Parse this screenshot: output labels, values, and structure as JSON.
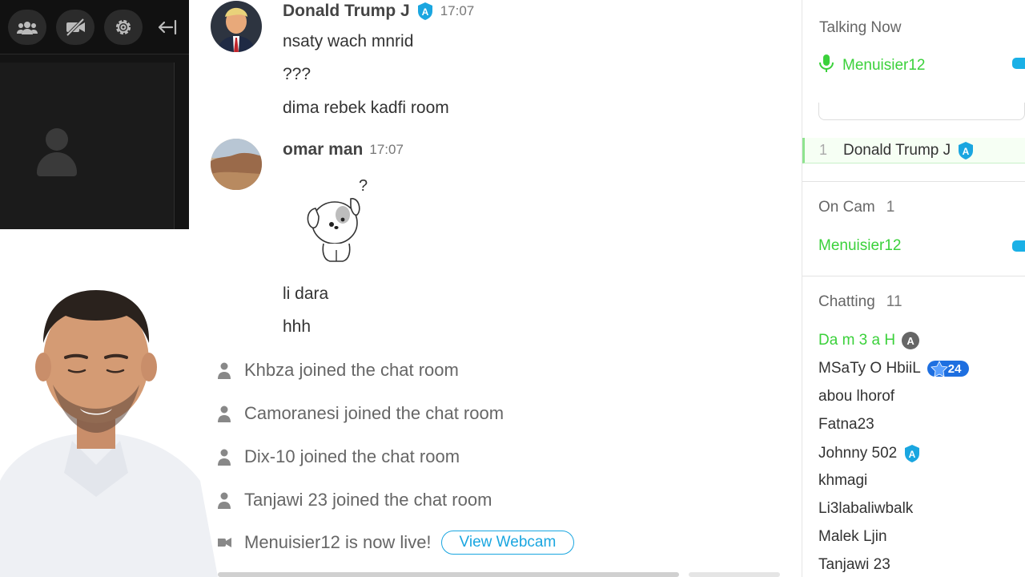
{
  "colors": {
    "accent_blue": "#1aa6e0",
    "talking_green": "#3bd13b",
    "badge_blue": "#1e6fe0"
  },
  "cam_toolbar": {
    "icons": [
      "users-icon",
      "camera-off-icon",
      "gear-icon",
      "collapse-left-icon"
    ]
  },
  "messages": [
    {
      "author": "Donald Trump J",
      "time": "17:07",
      "lines": [
        "nsaty wach mnrid",
        "???",
        "dima rebek kadfi room"
      ]
    },
    {
      "author": "omar man",
      "time": "17:07",
      "sticker_text": "?",
      "lines": [
        "li dara",
        "hhh"
      ]
    }
  ],
  "system_events": [
    "Khbza joined the chat room",
    "Camoranesi joined the chat room",
    "Dix-10 joined the chat room",
    "Tanjawi 23 joined the chat room"
  ],
  "live_event": {
    "text": "Menuisier12 is now live!",
    "button": "View Webcam"
  },
  "userlist": {
    "talking_now": {
      "title": "Talking Now",
      "user": "Menuisier12"
    },
    "queue": {
      "number": "1",
      "user": "Donald Trump J"
    },
    "on_cam": {
      "title": "On Cam",
      "count": "1",
      "users": [
        "Menuisier12"
      ]
    },
    "chatting": {
      "title": "Chatting",
      "count": "11",
      "users": [
        {
          "name": "Da m 3 a H",
          "badge": "A"
        },
        {
          "name": "MSaTy O HbiiL",
          "level": "24"
        },
        {
          "name": "abou lhorof"
        },
        {
          "name": "Fatna23"
        },
        {
          "name": "Johnny 502",
          "badge": "A"
        },
        {
          "name": "khmagi"
        },
        {
          "name": "Li3labaliwbalk"
        },
        {
          "name": "Malek Ljin"
        },
        {
          "name": "Tanjawi 23"
        }
      ]
    }
  }
}
